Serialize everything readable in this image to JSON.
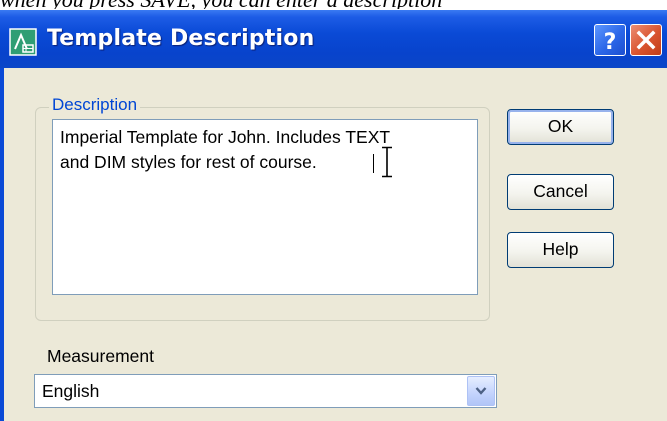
{
  "document": {
    "partial_text": "when you press SAVE, you can enter a description"
  },
  "dialog": {
    "title": "Template Description",
    "help_icon": "question-mark-icon",
    "close_icon": "close-x-icon",
    "description_group_label": "Description",
    "description_lines": [
      "Imperial Template for John. Includes TEXT",
      "and DIM styles for rest of course."
    ],
    "buttons": {
      "ok": "OK",
      "cancel": "Cancel",
      "help": "Help"
    },
    "measurement_label": "Measurement",
    "measurement_value": "English"
  },
  "colors": {
    "titlebar": "#0a4ad6",
    "dialog_background": "#ece9d8",
    "group_label": "#0046d5",
    "close_button": "#d9542f"
  }
}
